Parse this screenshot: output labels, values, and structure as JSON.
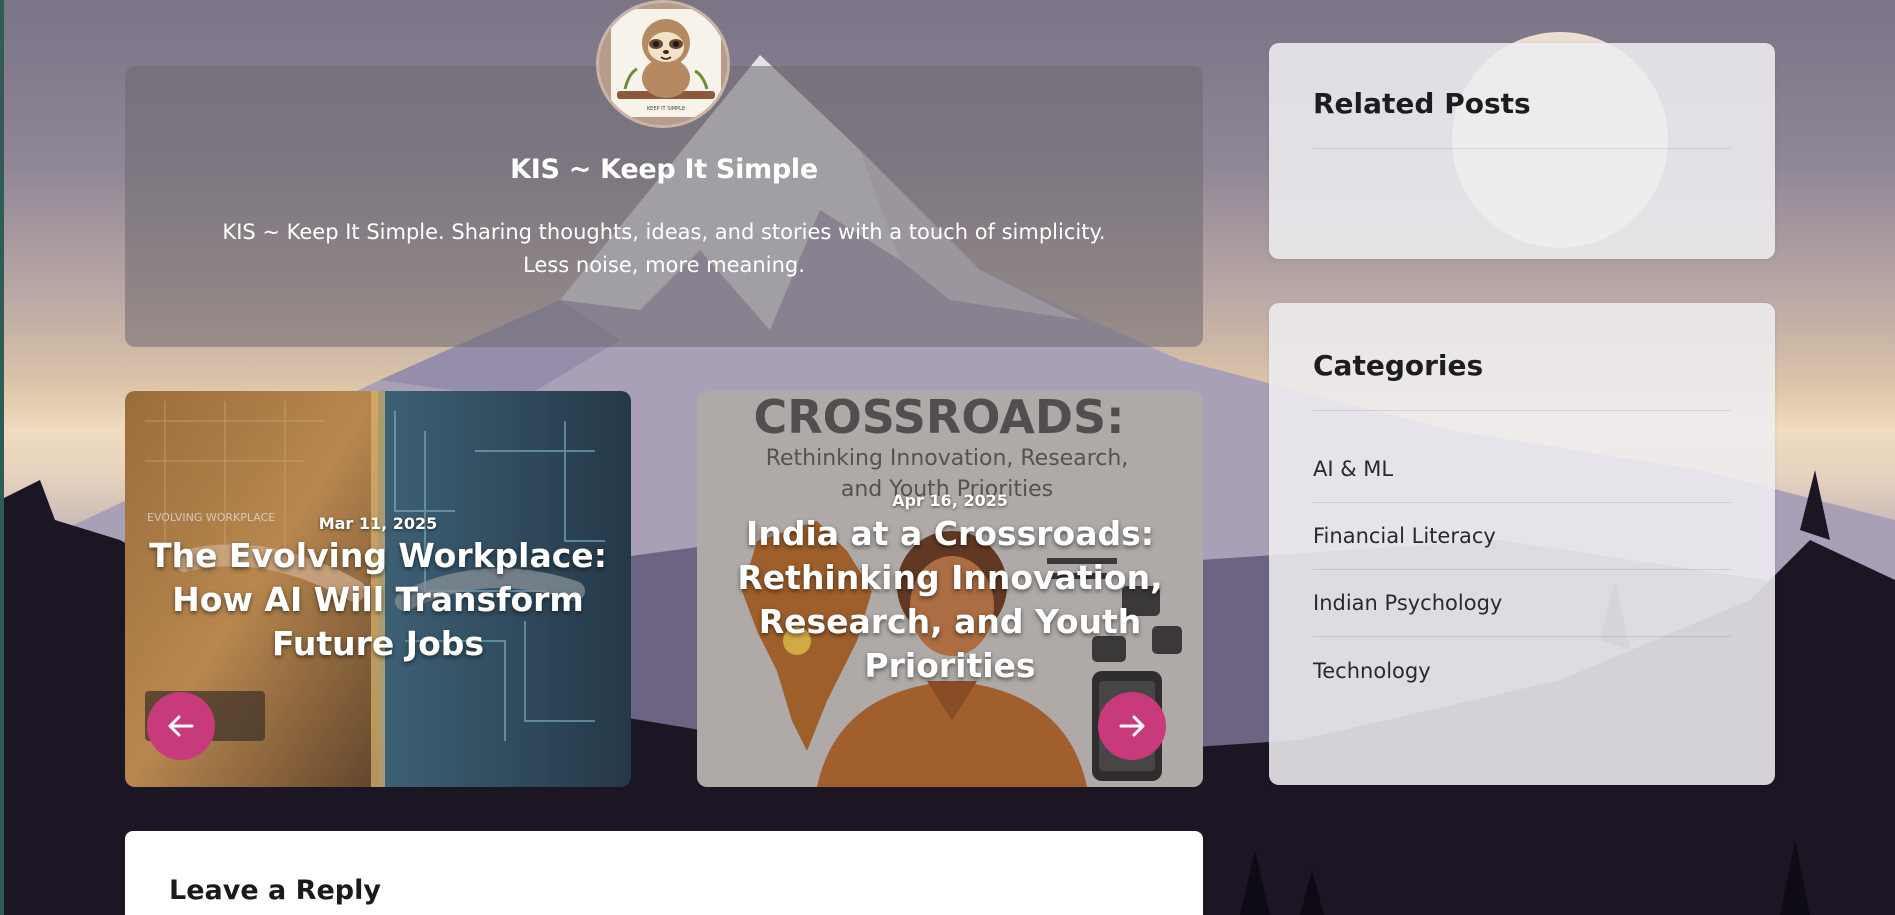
{
  "author": {
    "name": "KIS ~ Keep It Simple",
    "description": "KIS ~ Keep It Simple. Sharing thoughts, ideas, and stories with a touch of simplicity. Less noise, more meaning.",
    "avatar_caption": "KEEP IT SIMPLE"
  },
  "post_nav": {
    "previous": {
      "date": "Mar 11, 2025",
      "title": "The Evolving Workplace: How AI Will Transform Future Jobs",
      "image_text": "EVOLVING WORKPLACE",
      "button_icon": "arrow-left-icon"
    },
    "next": {
      "date": "Apr 16, 2025",
      "title": "India at a Crossroads: Rethinking Innovation, Research, and Youth Priorities",
      "image_heading": "CROSSROADS:",
      "image_subheading": "Rethinking Innovation, Research, and Youth Priorities",
      "button_icon": "arrow-right-icon"
    }
  },
  "reply": {
    "title": "Leave a Reply"
  },
  "sidebar": {
    "related_posts": {
      "title": "Related Posts"
    },
    "categories": {
      "title": "Categories",
      "items": [
        "AI & ML",
        "Financial Literacy",
        "Indian Psychology",
        "Technology"
      ]
    }
  },
  "colors": {
    "accent": "#c93a7c",
    "card_bg": "#ffffff"
  }
}
